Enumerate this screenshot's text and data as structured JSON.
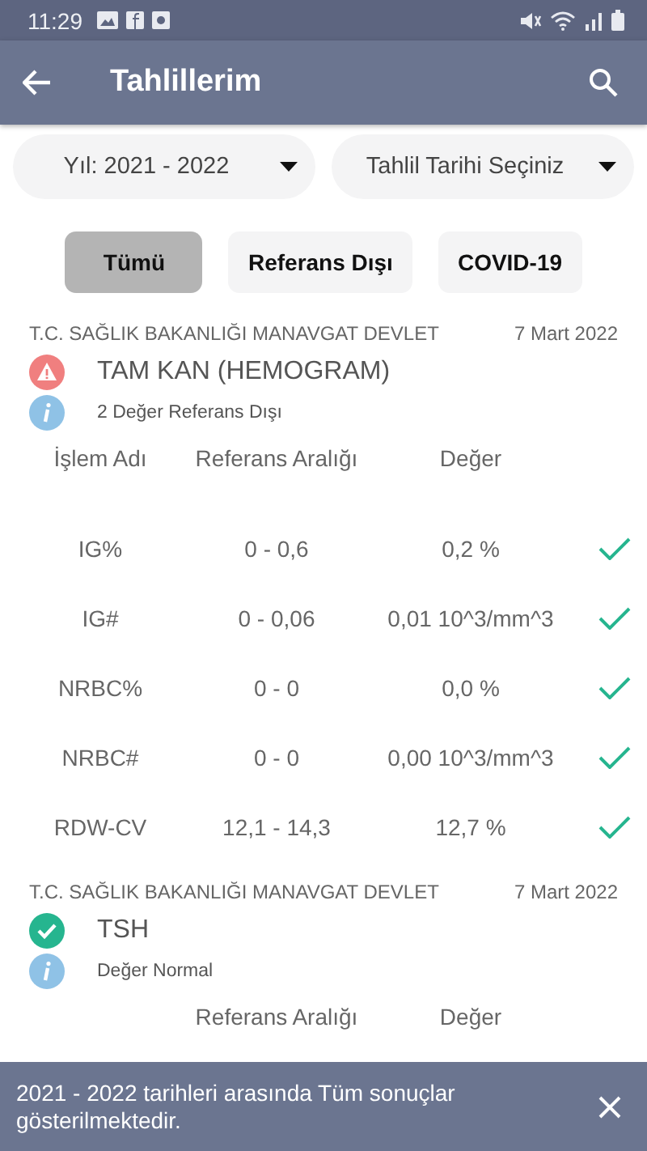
{
  "status_bar": {
    "time": "11:29"
  },
  "app_bar": {
    "title": "Tahlillerim"
  },
  "filters": [
    {
      "label": "Yıl: 2021 - 2022"
    },
    {
      "label": "Tahlil Tarihi Seçiniz"
    }
  ],
  "chips": [
    {
      "label": "Tümü",
      "selected": true
    },
    {
      "label": "Referans Dışı",
      "selected": false
    },
    {
      "label": "COVID-19",
      "selected": false
    }
  ],
  "results": [
    {
      "hospital": "T.C. SAĞLIK BAKANLIĞI MANAVGAT DEVLET",
      "date": "7 Mart 2022",
      "kind": "warning",
      "title": "TAM KAN (HEMOGRAM)",
      "summary": "2 Değer Referans Dışı",
      "columns": [
        "İşlem Adı",
        "Referans Aralığı",
        "Değer"
      ],
      "rows": [
        {
          "name": "IG%",
          "range": "0 - 0,6",
          "value": "0,2 %",
          "normal": true
        },
        {
          "name": "IG#",
          "range": "0 - 0,06",
          "value": "0,01 10^3/mm^3",
          "normal": true
        },
        {
          "name": "NRBC%",
          "range": "0 - 0",
          "value": "0,0 %",
          "normal": true
        },
        {
          "name": "NRBC#",
          "range": "0 - 0",
          "value": "0,00 10^3/mm^3",
          "normal": true
        },
        {
          "name": "RDW-CV",
          "range": "12,1 - 14,3",
          "value": "12,7 %",
          "normal": true
        }
      ]
    },
    {
      "hospital": "T.C. SAĞLIK BAKANLIĞI MANAVGAT DEVLET",
      "date": "7 Mart 2022",
      "kind": "ok",
      "title": "TSH",
      "summary": "Değer Normal",
      "columns": [
        "",
        "Referans Aralığı",
        "Değer"
      ]
    }
  ],
  "snackbar": {
    "message": "2021 - 2022 tarihleri arasında Tüm sonuçlar gösterilmektedir."
  }
}
